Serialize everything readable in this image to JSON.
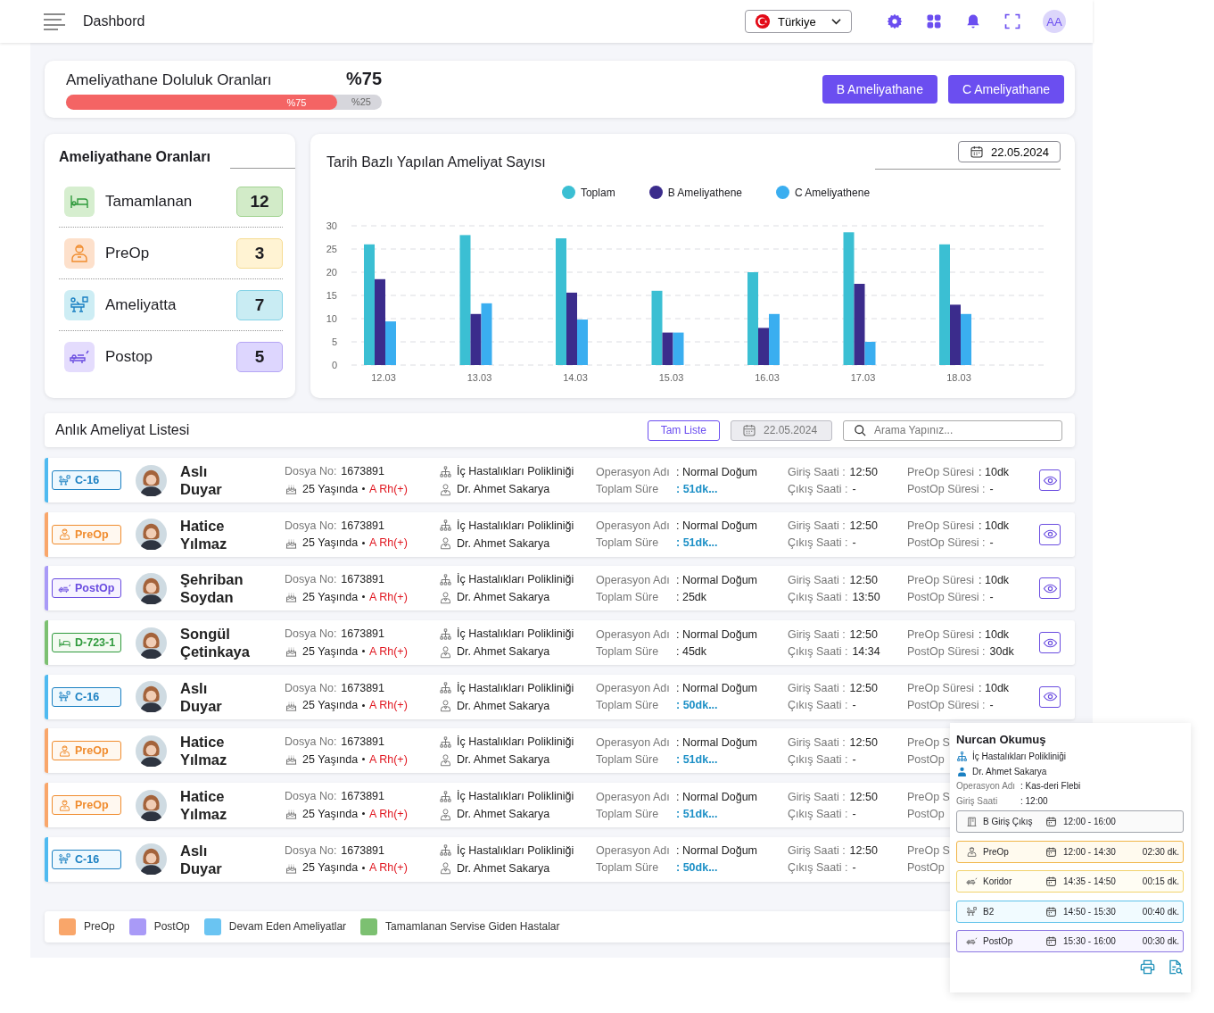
{
  "topbar": {
    "title": "Dashbord",
    "country": "Türkiye",
    "avatar": "AA"
  },
  "occupancy": {
    "title": "Ameliyathane Doluluk Oranları",
    "percent": "%75",
    "level": 0.86,
    "fill_label": "%75",
    "rest_label": "%25",
    "buttons": [
      "B Ameliyathane",
      "C Ameliyathane"
    ]
  },
  "stats": {
    "title": "Ameliyathane Oranları",
    "items": [
      {
        "kind": "done",
        "label": "Tamamlanan",
        "count": "12"
      },
      {
        "kind": "preop",
        "label": "PreOp",
        "count": "3"
      },
      {
        "kind": "room",
        "label": "Ameliyatta",
        "count": "7"
      },
      {
        "kind": "postop",
        "label": "Postop",
        "count": "5"
      }
    ]
  },
  "chart": {
    "title": "Tarih Bazlı Yapılan Ameliyat Sayısı",
    "date": "22.05.2024",
    "chart_data": {
      "type": "bar",
      "grid": true,
      "categories": [
        "12.03",
        "13.03",
        "14.03",
        "15.03",
        "16.03",
        "17.03",
        "18.03"
      ],
      "yticks": [
        0,
        5,
        10,
        15,
        20,
        25,
        30
      ],
      "ylim": [
        0,
        30
      ],
      "series": [
        {
          "name": "Toplam",
          "color": "#3bbfd3",
          "values": [
            26,
            28,
            27.3,
            16,
            20,
            28.6,
            26
          ]
        },
        {
          "name": "B Ameliyathene",
          "color": "#3b2c8c",
          "values": [
            18.5,
            11,
            15.6,
            7,
            8,
            17.5,
            13
          ]
        },
        {
          "name": "C Ameliyathene",
          "color": "#3aaef0",
          "values": [
            9.4,
            13.3,
            9.8,
            7,
            11,
            5,
            11
          ]
        }
      ]
    }
  },
  "list": {
    "title": "Anlık Ameliyat Listesi",
    "full_list": "Tam Liste",
    "date": "22.05.2024",
    "search": {
      "placeholder": "Arama Yapınız..."
    },
    "rows": [
      {
        "kind": "room",
        "tag": "C-16",
        "name": "Aslı Duyar",
        "file_label": "Dosya No:",
        "file_no": "1673891",
        "age": "25 Yaşında",
        "blood": "A Rh(+)",
        "dept": "İç Hastalıkları Polikliniği",
        "doctor": "Dr. Ahmet Sakarya",
        "op_label": "Operasyon Adı",
        "op": ": Normal Doğum",
        "total_label": "Toplam Süre",
        "total": ": 51dk...",
        "running": true,
        "in_label": "Giriş Saati :",
        "in": "12:50",
        "out_label": "Çıkış Saati :",
        "out": "-",
        "preop_label": "PreOp Süresi",
        "preop": ": 10dk",
        "postop_label": "PostOp Süresi :",
        "postop": "-",
        "view": true
      },
      {
        "kind": "preop",
        "tag": "PreOp",
        "name": "Hatice Yılmaz",
        "file_label": "Dosya No:",
        "file_no": "1673891",
        "age": "25 Yaşında",
        "blood": "A Rh(+)",
        "dept": "İç Hastalıkları Polikliniği",
        "doctor": "Dr. Ahmet Sakarya",
        "op_label": "Operasyon Adı",
        "op": ": Normal Doğum",
        "total_label": "Toplam Süre",
        "total": ": 51dk...",
        "running": true,
        "in_label": "Giriş Saati :",
        "in": "12:50",
        "out_label": "Çıkış Saati :",
        "out": "-",
        "preop_label": "PreOp Süresi",
        "preop": ": 10dk",
        "postop_label": "PostOp Süresi :",
        "postop": "-",
        "view": true
      },
      {
        "kind": "postop",
        "tag": "PostOp",
        "name": "Şehriban Soydan",
        "file_label": "Dosya No:",
        "file_no": "1673891",
        "age": "25 Yaşında",
        "blood": "A Rh(+)",
        "dept": "İç Hastalıkları Polikliniği",
        "doctor": "Dr. Ahmet Sakarya",
        "op_label": "Operasyon Adı",
        "op": ": Normal Doğum",
        "total_label": "Toplam Süre",
        "total": ": 25dk",
        "running": false,
        "in_label": "Giriş Saati :",
        "in": "12:50",
        "out_label": "Çıkış Saati :",
        "out": "13:50",
        "preop_label": "PreOp Süresi",
        "preop": ": 10dk",
        "postop_label": "PostOp Süresi :",
        "postop": "-",
        "view": true
      },
      {
        "kind": "done",
        "tag": "D-723-1",
        "name": "Songül Çetinkaya",
        "file_label": "Dosya No:",
        "file_no": "1673891",
        "age": "25 Yaşında",
        "blood": "A Rh(+)",
        "dept": "İç Hastalıkları Polikliniği",
        "doctor": "Dr. Ahmet Sakarya",
        "op_label": "Operasyon Adı",
        "op": ": Normal Doğum",
        "total_label": "Toplam Süre",
        "total": ": 45dk",
        "running": false,
        "in_label": "Giriş Saati :",
        "in": "12:50",
        "out_label": "Çıkış Saati :",
        "out": "14:34",
        "preop_label": "PreOp Süresi",
        "preop": ": 10dk",
        "postop_label": "PostOp Süresi :",
        "postop": "30dk",
        "view": true
      },
      {
        "kind": "room",
        "tag": "C-16",
        "name": "Aslı Duyar",
        "file_label": "Dosya No:",
        "file_no": "1673891",
        "age": "25 Yaşında",
        "blood": "A Rh(+)",
        "dept": "İç Hastalıkları Polikliniği",
        "doctor": "Dr. Ahmet Sakarya",
        "op_label": "Operasyon Adı",
        "op": ": Normal Doğum",
        "total_label": "Toplam Süre",
        "total": ": 50dk...",
        "running": true,
        "in_label": "Giriş Saati :",
        "in": "12:50",
        "out_label": "Çıkış Saati :",
        "out": "-",
        "preop_label": "PreOp Süresi",
        "preop": ": 10dk",
        "postop_label": "PostOp Süresi :",
        "postop": "-",
        "view": true
      },
      {
        "kind": "preop",
        "tag": "PreOp",
        "name": "Hatice Yılmaz",
        "file_label": "Dosya No:",
        "file_no": "1673891",
        "age": "25 Yaşında",
        "blood": "A Rh(+)",
        "dept": "İç Hastalıkları Polikliniği",
        "doctor": "Dr. Ahmet Sakarya",
        "op_label": "Operasyon Adı",
        "op": ": Normal Doğum",
        "total_label": "Toplam Süre",
        "total": ": 51dk...",
        "running": true,
        "in_label": "Giriş Saati :",
        "in": "12:50",
        "out_label": "Çıkış Saati :",
        "out": "-",
        "preop_label": "PreOp S",
        "postop_label": "PostOp",
        "view": false
      },
      {
        "kind": "preop",
        "tag": "PreOp",
        "name": "Hatice Yılmaz",
        "file_label": "Dosya No:",
        "file_no": "1673891",
        "age": "25 Yaşında",
        "blood": "A Rh(+)",
        "dept": "İç Hastalıkları Polikliniği",
        "doctor": "Dr. Ahmet Sakarya",
        "op_label": "Operasyon Adı",
        "op": ": Normal Doğum",
        "total_label": "Toplam Süre",
        "total": ": 51dk...",
        "running": true,
        "in_label": "Giriş Saati :",
        "in": "12:50",
        "out_label": "Çıkış Saati :",
        "out": "-",
        "preop_label": "PreOp S",
        "postop_label": "PostOp",
        "view": false
      },
      {
        "kind": "room",
        "tag": "C-16",
        "name": "Aslı Duyar",
        "file_label": "Dosya No:",
        "file_no": "1673891",
        "age": "25 Yaşında",
        "blood": "A Rh(+)",
        "dept": "İç Hastalıkları Polikliniği",
        "doctor": "Dr. Ahmet Sakarya",
        "op_label": "Operasyon Adı",
        "op": ": Normal Doğum",
        "total_label": "Toplam Süre",
        "total": ": 50dk...",
        "running": true,
        "in_label": "Giriş Saati :",
        "in": "12:50",
        "out_label": "Çıkış Saati :",
        "out": "-",
        "preop_label": "PreOp S",
        "postop_label": "PostOp",
        "view": false
      }
    ]
  },
  "legend": [
    {
      "label": "PreOp",
      "color": "#f9a66a"
    },
    {
      "label": "PostOp",
      "color": "#a99af7"
    },
    {
      "label": "Devam Eden Ameliyatlar",
      "color": "#6ac4f2"
    },
    {
      "label": "Tamamlanan Servise Giden Hastalar",
      "color": "#7cc071"
    }
  ],
  "popup": {
    "name": "Nurcan Okumuş",
    "dept": "İç Hastalıkları Polikliniği",
    "doctor": "Dr. Ahmet Sakarya",
    "op_label": "Operasyon Adı",
    "op": ": Kas-deri Flebi",
    "in_label": "Giriş Saati",
    "in": ": 12:00",
    "steps": [
      {
        "kind": "gate",
        "label": "B Giriş Çıkış",
        "time": "12:00 - 16:00"
      },
      {
        "kind": "preop",
        "label": "PreOp",
        "time": "12:00 - 14:30",
        "duration": "02:30 dk."
      },
      {
        "kind": "corridor",
        "label": "Koridor",
        "time": "14:35 - 14:50",
        "duration": "00:15 dk."
      },
      {
        "kind": "room",
        "label": "B2",
        "time": "14:50 - 15:30",
        "duration": "00:40 dk."
      },
      {
        "kind": "postop",
        "label": "PostOp",
        "time": "15:30 - 16:00",
        "duration": "00:30 dk."
      }
    ]
  }
}
